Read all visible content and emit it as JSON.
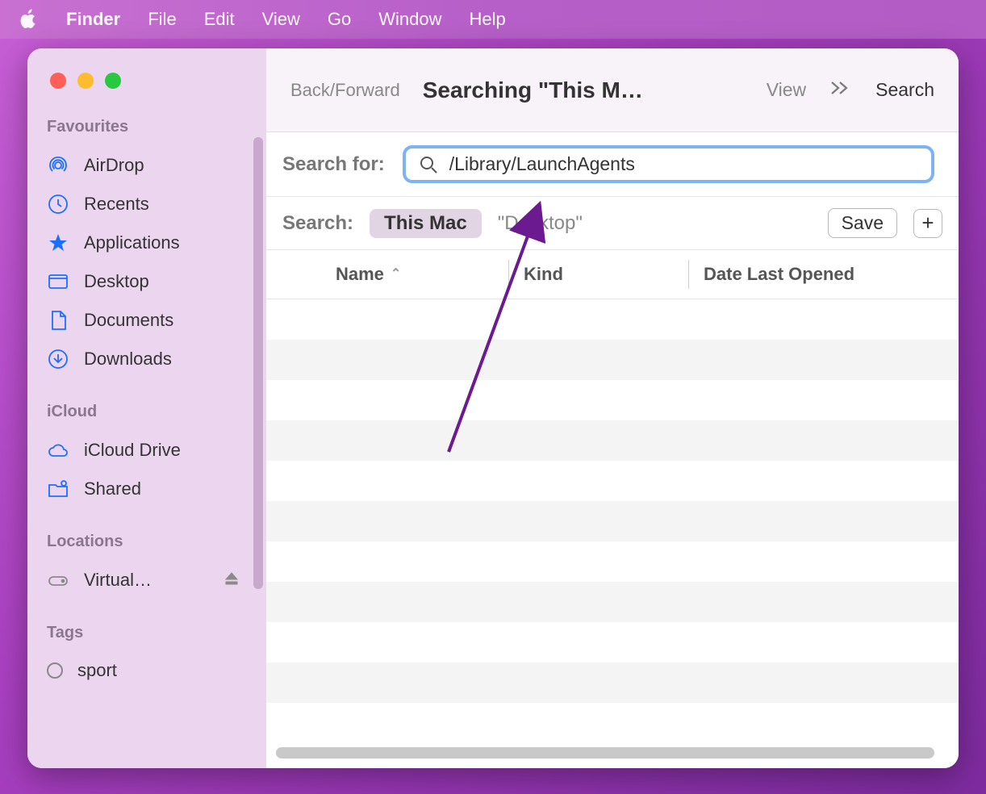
{
  "menubar": {
    "app": "Finder",
    "items": [
      "File",
      "Edit",
      "View",
      "Go",
      "Window",
      "Help"
    ]
  },
  "toolbar": {
    "back_forward": "Back/Forward",
    "title": "Searching \"This M…",
    "view": "View",
    "search": "Search"
  },
  "search_for": {
    "label": "Search for:",
    "value": "/Library/LaunchAgents"
  },
  "scope": {
    "label": "Search:",
    "active": "This Mac",
    "inactive": "\"Desktop\"",
    "save": "Save"
  },
  "columns": {
    "name": "Name",
    "kind": "Kind",
    "date": "Date Last Opened"
  },
  "sidebar": {
    "favourites_label": "Favourites",
    "favourites": [
      {
        "label": "AirDrop",
        "icon": "airdrop"
      },
      {
        "label": "Recents",
        "icon": "clock"
      },
      {
        "label": "Applications",
        "icon": "apps"
      },
      {
        "label": "Desktop",
        "icon": "desktop"
      },
      {
        "label": "Documents",
        "icon": "document"
      },
      {
        "label": "Downloads",
        "icon": "download"
      }
    ],
    "icloud_label": "iCloud",
    "icloud": [
      {
        "label": "iCloud Drive",
        "icon": "cloud"
      },
      {
        "label": "Shared",
        "icon": "shared"
      }
    ],
    "locations_label": "Locations",
    "locations": [
      {
        "label": "Virtual…",
        "icon": "drive",
        "eject": true
      }
    ],
    "tags_label": "Tags",
    "tags": [
      {
        "label": "sport"
      }
    ]
  }
}
